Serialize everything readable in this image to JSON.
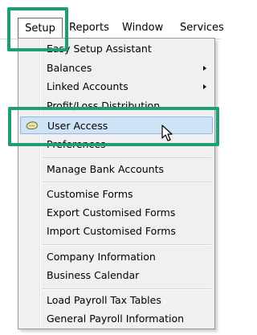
{
  "menubar": {
    "items": [
      "Setup",
      "Reports",
      "Window",
      "Services"
    ]
  },
  "setup_menu": {
    "items": [
      {
        "label": "Easy Setup Assistant"
      },
      {
        "label": "Balances",
        "submenu": true
      },
      {
        "label": "Linked Accounts",
        "submenu": true
      },
      {
        "label": "Profit/Loss Distribution"
      },
      {
        "label": "User Access",
        "highlighted": true,
        "icon": "user-access-icon"
      },
      {
        "label": "Preferences"
      },
      {
        "label": "Manage Bank Accounts"
      },
      {
        "label": "Customise Forms"
      },
      {
        "label": "Export Customised Forms"
      },
      {
        "label": "Import Customised Forms"
      },
      {
        "label": "Company Information"
      },
      {
        "label": "Business Calendar"
      },
      {
        "label": "Load Payroll Tax Tables"
      },
      {
        "label": "General Payroll Information"
      }
    ]
  },
  "colors": {
    "callout": "#1e9e74",
    "hover_fill": "#cfe3f6",
    "hover_border": "#8fb7e4",
    "menu_bg": "#f0f0f0"
  }
}
